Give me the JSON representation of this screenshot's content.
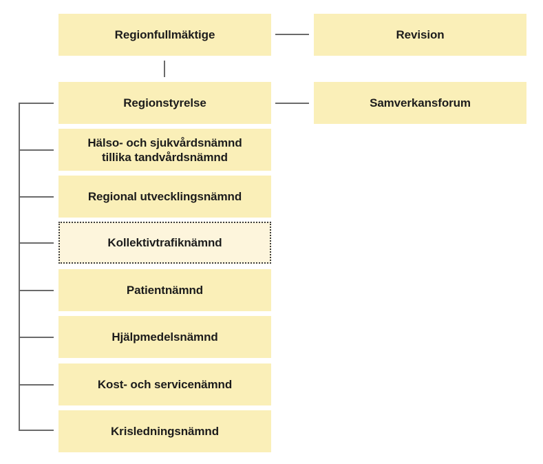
{
  "diagram": {
    "top": {
      "main": "Regionfullmäktige",
      "side": "Revision"
    },
    "board": {
      "main": "Regionstyrelse",
      "side": "Samverkansforum"
    },
    "committees": [
      {
        "label": "Hälso- och sjukvårdsnämnd\ntillika tandvårdsnämnd",
        "line1": "Hälso- och sjukvårdsnämnd",
        "line2": "tillika tandvårdsnämnd",
        "style": "solid"
      },
      {
        "label": "Regional utvecklingsnämnd",
        "style": "solid"
      },
      {
        "label": "Kollektivtrafiknämnd",
        "style": "dotted"
      },
      {
        "label": "Patientnämnd",
        "style": "solid"
      },
      {
        "label": "Hjälpmedelsnämnd",
        "style": "solid"
      },
      {
        "label": "Kost- och servicenämnd",
        "style": "solid"
      },
      {
        "label": "Krisledningsnämnd",
        "style": "solid"
      }
    ],
    "colors": {
      "box_fill": "#faefb8",
      "dotted_box_fill": "#fdf5dc",
      "line": "#6a6a6a",
      "text": "#1c1c1c"
    }
  }
}
